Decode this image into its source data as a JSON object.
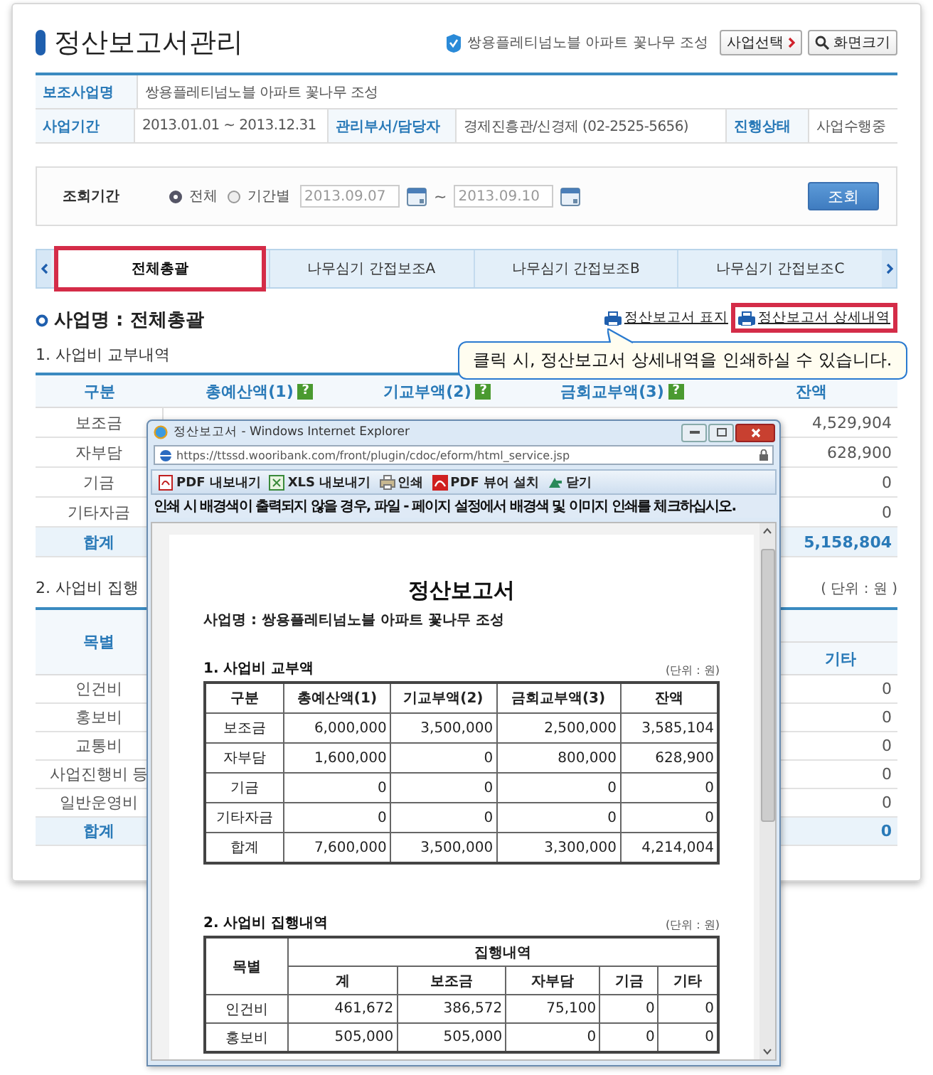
{
  "header": {
    "title": "정산보고서관리",
    "project": "쌍용플레티넘노블 아파트 꽃나무 조성",
    "buttons": [
      {
        "label": "사업선택",
        "kind": "select"
      },
      {
        "label": "화면크기",
        "kind": "zoom"
      }
    ]
  },
  "info": {
    "rows": [
      [
        {
          "label": "보조사업명",
          "value": "쌍용플레티넘노블 아파트 꽃나무 조성"
        }
      ],
      [
        {
          "label": "사업기간",
          "value": "2013.01.01 ~ 2013.12.31"
        },
        {
          "label": "관리부서/담당자",
          "value": "경제진흥관/신경제 (02-2525-5656)"
        },
        {
          "label": "진행상태",
          "value": "사업수행중"
        }
      ]
    ]
  },
  "search": {
    "label": "조회기간",
    "options": [
      {
        "label": "전체",
        "selected": true
      },
      {
        "label": "기간별",
        "selected": false
      }
    ],
    "date_from": "2013.09.07",
    "separator": "~",
    "date_to": "2013.09.10",
    "button": "조회"
  },
  "tabs": [
    {
      "label": "전체총괄",
      "selected": true,
      "highlighted": true
    },
    {
      "label": "나무심기 간접보조A",
      "selected": false,
      "highlighted": false
    },
    {
      "label": "나무심기 간접보조B",
      "selected": false,
      "highlighted": false
    },
    {
      "label": "나무심기 간접보조C",
      "selected": false,
      "highlighted": false
    }
  ],
  "section": {
    "title": "사업명 : 전체총괄",
    "links": [
      {
        "label": "정산보고서 표지",
        "highlighted": false
      },
      {
        "label": "정산보고서 상세내역",
        "highlighted": true
      }
    ]
  },
  "tooltip": "클릭 시, 정산보고서 상세내역을 인쇄하실 수 있습니다.",
  "budget": {
    "title": "1. 사업비 교부내역",
    "columns": [
      {
        "label": "구분"
      },
      {
        "label": "총예산액(1)",
        "help": "?"
      },
      {
        "label": "기교부액(2)",
        "help": "?"
      },
      {
        "label": "금회교부액(3)",
        "help": "?"
      },
      {
        "label": "잔액"
      }
    ],
    "rows": [
      {
        "label": "보조금",
        "balance": "4,529,904",
        "total": false
      },
      {
        "label": "자부담",
        "balance": "628,900",
        "total": false
      },
      {
        "label": "기금",
        "balance": "0",
        "total": false
      },
      {
        "label": "기타자금",
        "balance": "0",
        "total": false
      },
      {
        "label": "합계",
        "balance": "5,158,804",
        "total": true
      }
    ]
  },
  "execution": {
    "title": "2. 사업비 집행",
    "unit": "( 단위 : 원 )",
    "columns": [
      "목별",
      "기타"
    ],
    "rows": [
      {
        "label": "인건비",
        "other": "0",
        "total": false
      },
      {
        "label": "홍보비",
        "other": "0",
        "total": false
      },
      {
        "label": "교통비",
        "other": "0",
        "total": false
      },
      {
        "label": "사업진행비 등",
        "other": "0",
        "total": false
      },
      {
        "label": "일반운영비",
        "other": "0",
        "total": false
      },
      {
        "label": "합계",
        "other": "0",
        "total": true
      }
    ]
  },
  "popup": {
    "title": "정산보고서 - Windows Internet Explorer",
    "url": "https://ttssd.wooribank.com/front/plugin/cdoc/eform/html_service.jsp",
    "toolbar": [
      {
        "label": "PDF 내보내기",
        "kind": "pdf"
      },
      {
        "label": "XLS 내보내기",
        "kind": "xls"
      },
      {
        "label": "인쇄",
        "kind": "print"
      },
      {
        "label": "PDF 뷰어 설치",
        "kind": "viewer"
      },
      {
        "label": "닫기",
        "kind": "close"
      }
    ],
    "notice": "인쇄 시 배경색이 출력되지 않을 경우, 파일 - 페이지 설정에서 배경색 및 이미지 인쇄를 체크하십시오.",
    "document": {
      "title": "정산보고서",
      "project": "사업명 : 쌍용플레티넘노블 아파트 꽃나무 조성",
      "budget": {
        "title": "1. 사업비 교부액",
        "unit": "(단위 : 원)",
        "columns": [
          "구분",
          "총예산액(1)",
          "기교부액(2)",
          "금회교부액(3)",
          "잔액"
        ],
        "rows": [
          [
            "보조금",
            "6,000,000",
            "3,500,000",
            "2,500,000",
            "3,585,104"
          ],
          [
            "자부담",
            "1,600,000",
            "0",
            "800,000",
            "628,900"
          ],
          [
            "기금",
            "0",
            "0",
            "0",
            "0"
          ],
          [
            "기타자금",
            "0",
            "0",
            "0",
            "0"
          ],
          [
            "합계",
            "7,600,000",
            "3,500,000",
            "3,300,000",
            "4,214,004"
          ]
        ]
      },
      "execution": {
        "title": "2. 사업비 집행내역",
        "unit": "(단위 : 원)",
        "header_rows": [
          [
            {
              "text": "목별",
              "rowspan": 2
            },
            {
              "text": "집행내역",
              "colspan": 5
            }
          ],
          [
            {
              "text": "계"
            },
            {
              "text": "보조금"
            },
            {
              "text": "자부담"
            },
            {
              "text": "기금"
            },
            {
              "text": "기타"
            }
          ]
        ],
        "rows": [
          [
            "인건비",
            "461,672",
            "386,572",
            "75,100",
            "0",
            "0"
          ],
          [
            "홍보비",
            "505,000",
            "505,000",
            "0",
            "0",
            "0"
          ]
        ]
      }
    }
  }
}
